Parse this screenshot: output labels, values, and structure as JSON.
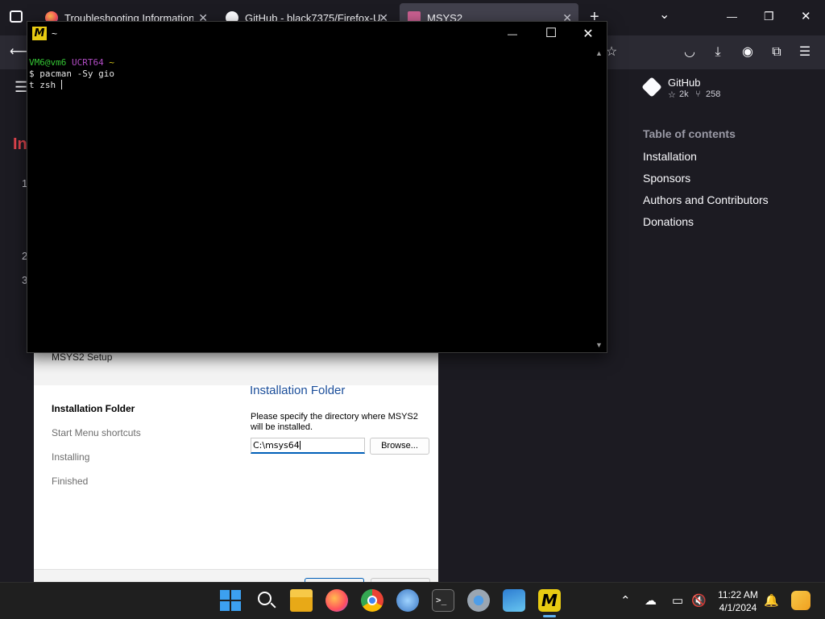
{
  "browser": {
    "tabs": [
      {
        "label": "Troubleshooting Information"
      },
      {
        "label": "GitHub - black7375/Firefox-UI-"
      },
      {
        "label": "MSYS2"
      }
    ],
    "new_tab": "+",
    "list_all_tabs": "⌄",
    "window_controls": {
      "minimize": "—",
      "restore": "❐",
      "close": "✕"
    }
  },
  "page": {
    "left_heading_fragment": "In",
    "list_fragments": [
      "1",
      "2",
      "3"
    ],
    "github_card": {
      "name": "GitHub",
      "stars": "2k",
      "forks": "258"
    },
    "toc": {
      "title": "Table of contents",
      "items": [
        "Installation",
        "Sponsors",
        "Authors and Contributors",
        "Donations"
      ]
    }
  },
  "installer": {
    "title": "MSYS2 Setup",
    "steps": [
      "Installation Folder",
      "Start Menu shortcuts",
      "Installing",
      "Finished"
    ],
    "current_step": 0,
    "heading": "Installation Folder",
    "description": "Please specify the directory where MSYS2 will be installed.",
    "folder_value": "C:\\msys64",
    "browse_label": "Browse..."
  },
  "terminal": {
    "title": "~",
    "prompt_user": "VM6@vm6",
    "prompt_env": "UCRT64",
    "prompt_path": "~",
    "command_line1": "$ pacman -Sy gio",
    "command_line2": "t zsh ",
    "window_controls": {
      "minimize": "—",
      "maximize": "☐",
      "close": "✕"
    }
  },
  "taskbar": {
    "time": "11:22 AM",
    "date": "4/1/2024"
  },
  "colors": {
    "terminal_bg": "#000000",
    "prompt_user": "#34c534",
    "prompt_env": "#b14cc4",
    "prompt_path": "#d9c91a",
    "installer_heading": "#1b4e9a",
    "msys_logo": "#e8cb12"
  }
}
